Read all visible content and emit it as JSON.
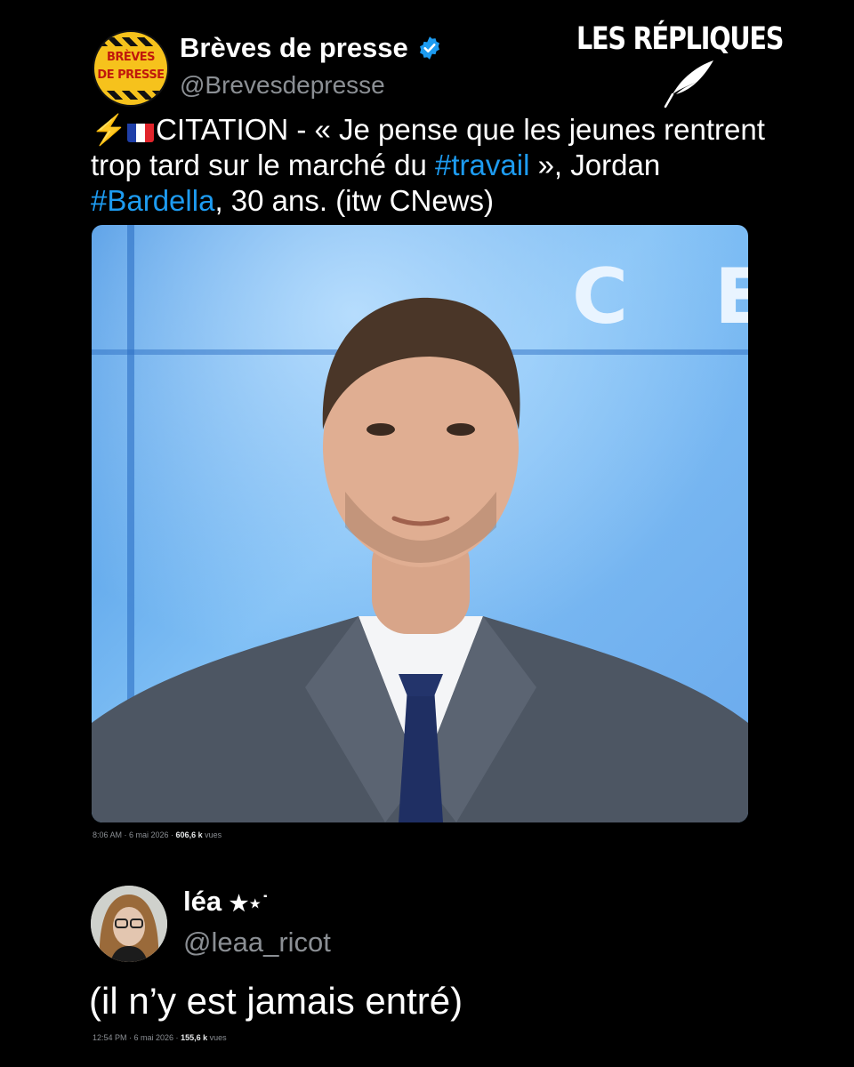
{
  "brand": {
    "title": "LES RÉPLIQUES"
  },
  "tweet": {
    "avatar_text_top": "BRÈVES",
    "avatar_text_bottom": "DE PRESSE",
    "name": "Brèves de presse",
    "verified": true,
    "handle": "@Brevesdepresse",
    "text_part1": "CITATION - « Je pense que les jeunes rentrent trop tard sur le marché du ",
    "hashtag1": "#travail",
    "text_part2": " », Jordan ",
    "hashtag2": "#Bardella",
    "text_part3": ", 30 ans. (itw CNews)",
    "time": "8:06 AM · 6 mai 2026 · ",
    "views_count": "606,6 k",
    "views_label": " vues"
  },
  "reply": {
    "name": "léa",
    "name_symbols": "★⋆˙",
    "handle": "@leaa_ricot",
    "text": "(il n’y est jamais entré)",
    "time": "12:54 PM · 6 mai 2026 · ",
    "views_count": "155,6 k",
    "views_label": " vues"
  },
  "colors": {
    "background": "#000000",
    "hashtag": "#1d9bf0",
    "verified": "#1d9bf0",
    "muted": "#8b8f94"
  },
  "icons": [
    "quill-icon",
    "verified-badge-icon",
    "lightning-icon",
    "france-flag-icon"
  ]
}
